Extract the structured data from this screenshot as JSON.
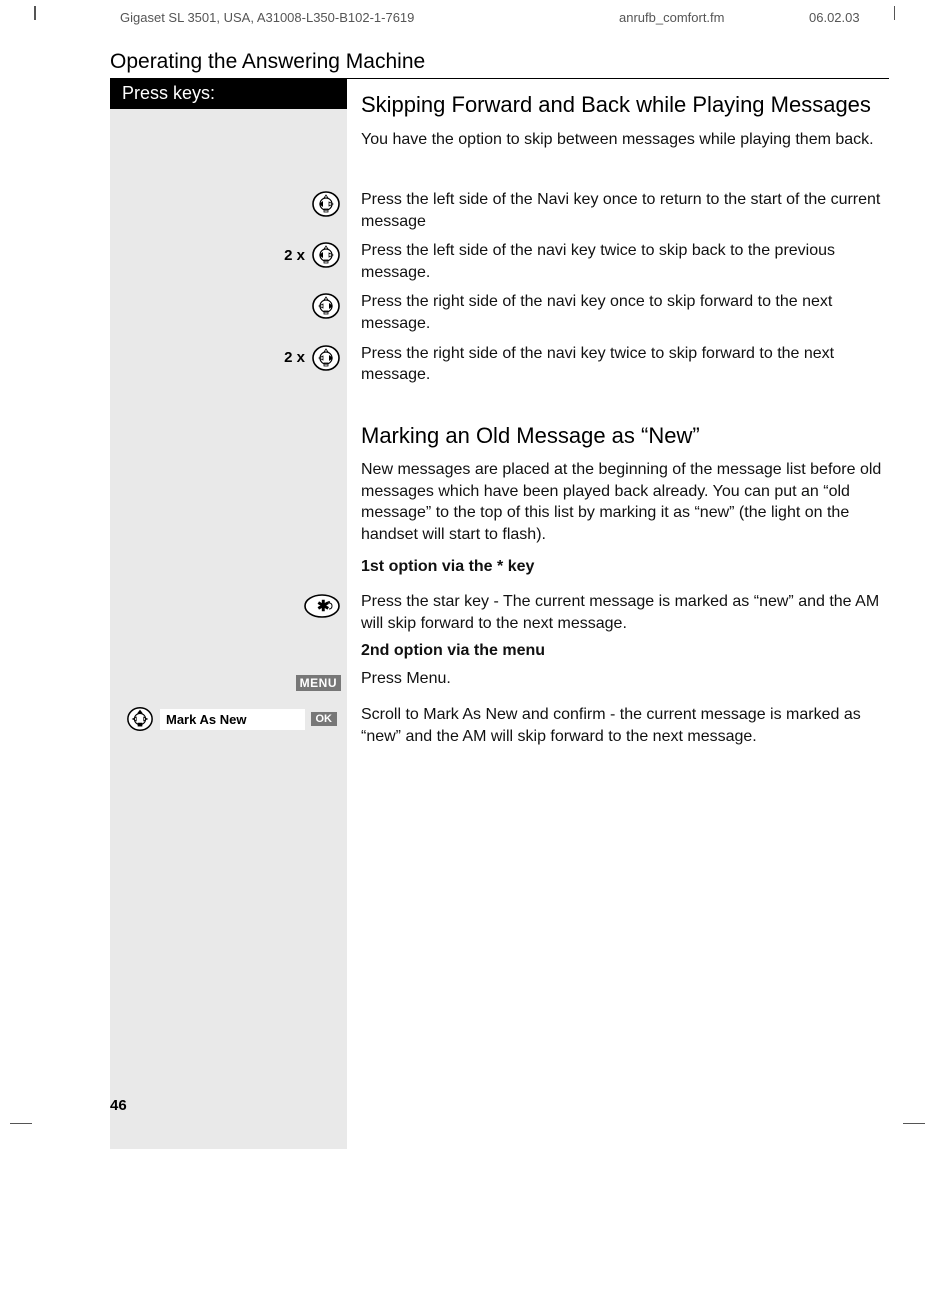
{
  "header": {
    "left": "Gigaset SL 3501, USA, A31008-L350-B102-1-7619",
    "mid": "anrufb_comfort.fm",
    "right": "06.02.03"
  },
  "section_title": "Operating the Answering Machine",
  "press_keys_label": "Press keys:",
  "heading1": "Skipping Forward and Back while Playing Messages",
  "intro1": "You have the option to skip between messages while playing them back.",
  "skip_left1": "Press the left side of the Navi key once to return to the start of the current message",
  "skip_left2_prefix": "2 x",
  "skip_left2": "Press the left side of the navi key twice to skip back to the previous message.",
  "skip_right1": "Press the right side of the navi key once to skip forward to the next message.",
  "skip_right2_prefix": "2 x",
  "skip_right2": "Press the right side of the navi key twice to skip forward to the next message.",
  "heading2": "Marking an Old Message as “New”",
  "intro2": "New messages are placed at the beginning of the message list before old messages which have been played back already.  You can put an “old message” to the top of this list by marking it as “new” (the light on the handset will start to flash).",
  "option1_label": "1st option via the * key",
  "option1_text": "Press the star key - The current message is marked as “new” and the AM will skip forward to the next message.",
  "option2_label": "2nd option via the menu",
  "menu_badge": "MENU",
  "menu_text": "Press Menu.",
  "mark_label": "Mark As New",
  "ok_badge": "OK",
  "mark_text": "Scroll to Mark As New and confirm - the current message is marked as “new” and the AM will skip forward to the next message.",
  "page_number": "46"
}
